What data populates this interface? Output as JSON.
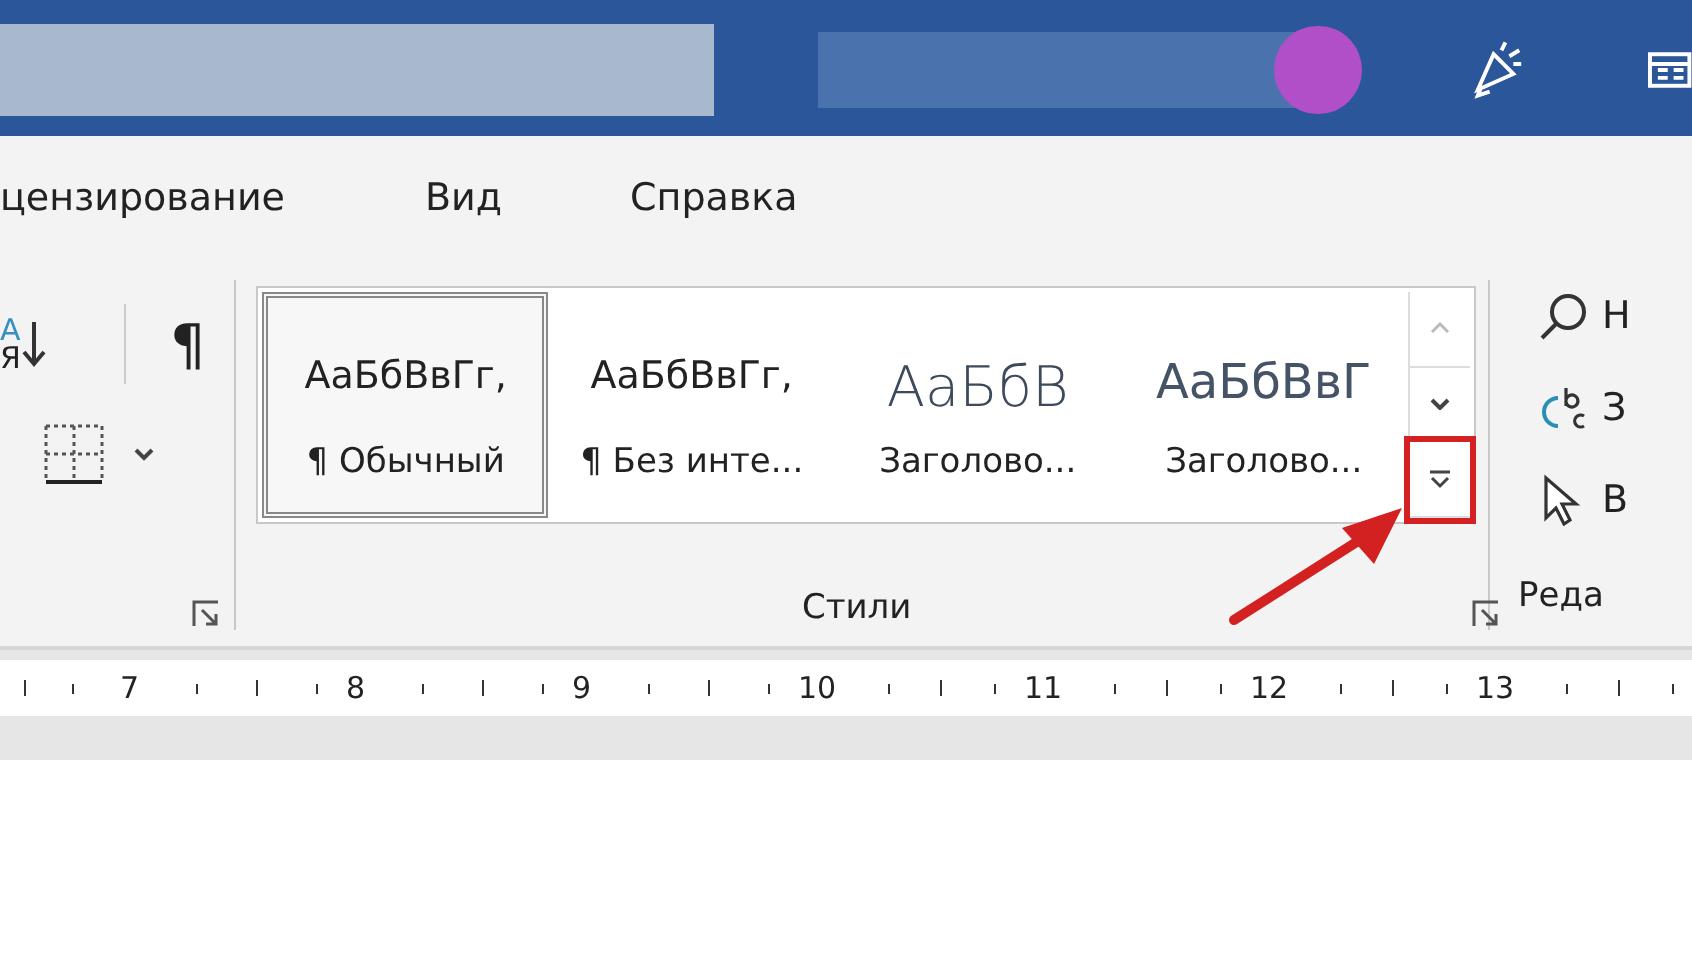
{
  "tabs": [
    {
      "label": "цензирование"
    },
    {
      "label": "Вид"
    },
    {
      "label": "Справка"
    }
  ],
  "paragraph_group": {
    "sort_letters": [
      "А",
      "Я"
    ],
    "pilcrow": "¶"
  },
  "styles_group": {
    "label": "Стили",
    "items": [
      {
        "preview": "АаБбВвГг,",
        "name": "¶ Обычный",
        "kind": "body",
        "selected": true
      },
      {
        "preview": "АаБбВвГг,",
        "name": "¶ Без инте...",
        "kind": "body",
        "selected": false
      },
      {
        "preview": "АаБбВ",
        "name": "Заголово...",
        "kind": "heading",
        "selected": false
      },
      {
        "preview": "АаБбВвГ",
        "name": "Заголово...",
        "kind": "subheading",
        "selected": false
      }
    ],
    "more_highlighted": true
  },
  "editing_group": {
    "label": "Реда",
    "items": [
      {
        "kind": "find",
        "label": "Н"
      },
      {
        "kind": "replace",
        "label": "З"
      },
      {
        "kind": "select",
        "label": "В"
      }
    ]
  },
  "ruler": {
    "numbers": [
      "7",
      "8",
      "9",
      "10",
      "11",
      "12",
      "13"
    ]
  }
}
